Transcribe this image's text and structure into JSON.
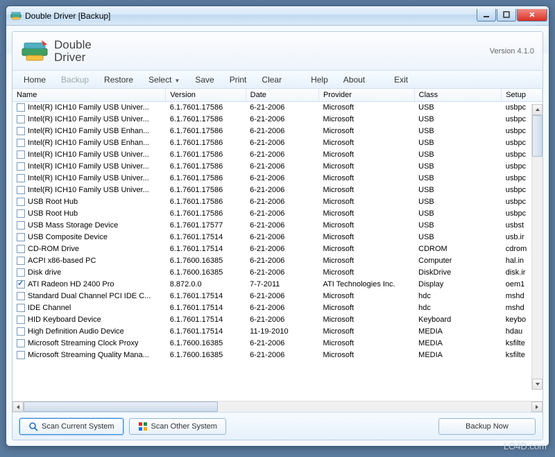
{
  "window": {
    "title": "Double Driver [Backup]"
  },
  "app": {
    "name_line1": "Double",
    "name_line2": "Driver",
    "version_label": "Version 4.1.0"
  },
  "menu": {
    "home": "Home",
    "backup": "Backup",
    "restore": "Restore",
    "select": "Select",
    "save": "Save",
    "print": "Print",
    "clear": "Clear",
    "help": "Help",
    "about": "About",
    "exit": "Exit"
  },
  "columns": {
    "name": "Name",
    "version": "Version",
    "date": "Date",
    "provider": "Provider",
    "class": "Class",
    "setup": "Setup"
  },
  "rows": [
    {
      "checked": false,
      "name": "Intel(R) ICH10 Family USB Univer...",
      "version": "6.1.7601.17586",
      "date": "6-21-2006",
      "provider": "Microsoft",
      "class": "USB",
      "setup": "usbpc"
    },
    {
      "checked": false,
      "name": "Intel(R) ICH10 Family USB Univer...",
      "version": "6.1.7601.17586",
      "date": "6-21-2006",
      "provider": "Microsoft",
      "class": "USB",
      "setup": "usbpc"
    },
    {
      "checked": false,
      "name": "Intel(R) ICH10 Family USB Enhan...",
      "version": "6.1.7601.17586",
      "date": "6-21-2006",
      "provider": "Microsoft",
      "class": "USB",
      "setup": "usbpc"
    },
    {
      "checked": false,
      "name": "Intel(R) ICH10 Family USB Enhan...",
      "version": "6.1.7601.17586",
      "date": "6-21-2006",
      "provider": "Microsoft",
      "class": "USB",
      "setup": "usbpc"
    },
    {
      "checked": false,
      "name": "Intel(R) ICH10 Family USB Univer...",
      "version": "6.1.7601.17586",
      "date": "6-21-2006",
      "provider": "Microsoft",
      "class": "USB",
      "setup": "usbpc"
    },
    {
      "checked": false,
      "name": "Intel(R) ICH10 Family USB Univer...",
      "version": "6.1.7601.17586",
      "date": "6-21-2006",
      "provider": "Microsoft",
      "class": "USB",
      "setup": "usbpc"
    },
    {
      "checked": false,
      "name": "Intel(R) ICH10 Family USB Univer...",
      "version": "6.1.7601.17586",
      "date": "6-21-2006",
      "provider": "Microsoft",
      "class": "USB",
      "setup": "usbpc"
    },
    {
      "checked": false,
      "name": "Intel(R) ICH10 Family USB Univer...",
      "version": "6.1.7601.17586",
      "date": "6-21-2006",
      "provider": "Microsoft",
      "class": "USB",
      "setup": "usbpc"
    },
    {
      "checked": false,
      "name": "USB Root Hub",
      "version": "6.1.7601.17586",
      "date": "6-21-2006",
      "provider": "Microsoft",
      "class": "USB",
      "setup": "usbpc"
    },
    {
      "checked": false,
      "name": "USB Root Hub",
      "version": "6.1.7601.17586",
      "date": "6-21-2006",
      "provider": "Microsoft",
      "class": "USB",
      "setup": "usbpc"
    },
    {
      "checked": false,
      "name": "USB Mass Storage Device",
      "version": "6.1.7601.17577",
      "date": "6-21-2006",
      "provider": "Microsoft",
      "class": "USB",
      "setup": "usbst"
    },
    {
      "checked": false,
      "name": "USB Composite Device",
      "version": "6.1.7601.17514",
      "date": "6-21-2006",
      "provider": "Microsoft",
      "class": "USB",
      "setup": "usb.ir"
    },
    {
      "checked": false,
      "name": "CD-ROM Drive",
      "version": "6.1.7601.17514",
      "date": "6-21-2006",
      "provider": "Microsoft",
      "class": "CDROM",
      "setup": "cdrom"
    },
    {
      "checked": false,
      "name": "ACPI x86-based PC",
      "version": "6.1.7600.16385",
      "date": "6-21-2006",
      "provider": "Microsoft",
      "class": "Computer",
      "setup": "hal.in"
    },
    {
      "checked": false,
      "name": "Disk drive",
      "version": "6.1.7600.16385",
      "date": "6-21-2006",
      "provider": "Microsoft",
      "class": "DiskDrive",
      "setup": "disk.ir"
    },
    {
      "checked": true,
      "name": "ATI Radeon HD 2400 Pro",
      "version": "8.872.0.0",
      "date": "7-7-2011",
      "provider": "ATI Technologies Inc.",
      "class": "Display",
      "setup": "oem1"
    },
    {
      "checked": false,
      "name": "Standard Dual Channel PCI IDE C...",
      "version": "6.1.7601.17514",
      "date": "6-21-2006",
      "provider": "Microsoft",
      "class": "hdc",
      "setup": "mshd"
    },
    {
      "checked": false,
      "name": "IDE Channel",
      "version": "6.1.7601.17514",
      "date": "6-21-2006",
      "provider": "Microsoft",
      "class": "hdc",
      "setup": "mshd"
    },
    {
      "checked": false,
      "name": "HID Keyboard Device",
      "version": "6.1.7601.17514",
      "date": "6-21-2006",
      "provider": "Microsoft",
      "class": "Keyboard",
      "setup": "keybo"
    },
    {
      "checked": false,
      "name": "High Definition Audio Device",
      "version": "6.1.7601.17514",
      "date": "11-19-2010",
      "provider": "Microsoft",
      "class": "MEDIA",
      "setup": "hdau"
    },
    {
      "checked": false,
      "name": "Microsoft Streaming Clock Proxy",
      "version": "6.1.7600.16385",
      "date": "6-21-2006",
      "provider": "Microsoft",
      "class": "MEDIA",
      "setup": "ksfilte"
    },
    {
      "checked": false,
      "name": "Microsoft Streaming Quality Mana...",
      "version": "6.1.7600.16385",
      "date": "6-21-2006",
      "provider": "Microsoft",
      "class": "MEDIA",
      "setup": "ksfilte"
    }
  ],
  "buttons": {
    "scan_current": "Scan Current System",
    "scan_other": "Scan Other System",
    "backup_now": "Backup Now"
  },
  "watermark": "LO4D.com"
}
